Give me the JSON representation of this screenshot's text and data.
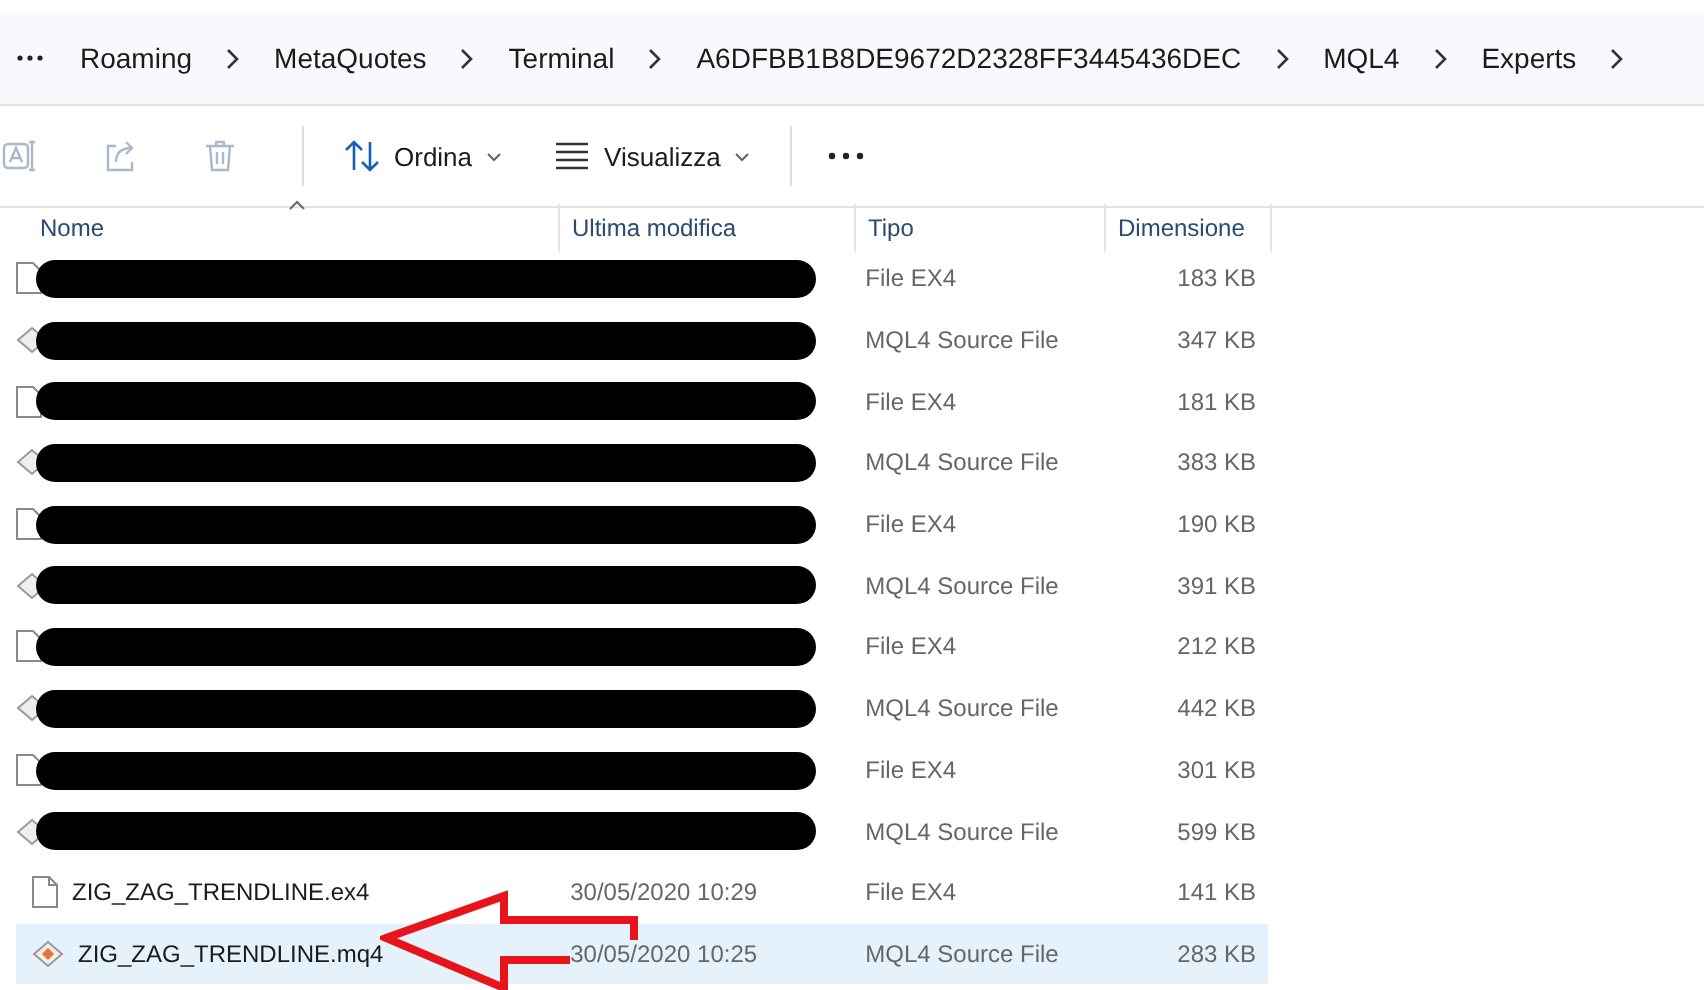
{
  "breadcrumb": [
    "Roaming",
    "MetaQuotes",
    "Terminal",
    "A6DFBB1B8DE9672D2328FF3445436DEC",
    "MQL4",
    "Experts"
  ],
  "toolbar": {
    "actions": [
      {
        "kind": "rename",
        "disabled": true
      },
      {
        "kind": "share",
        "disabled": true
      },
      {
        "kind": "delete",
        "disabled": true
      }
    ],
    "sort": "Ordina",
    "view": "Visualizza"
  },
  "columns": [
    "Nome",
    "Ultima modifica",
    "Tipo",
    "Dimensione"
  ],
  "rows": [
    {
      "kind": "ex4",
      "redacted": true,
      "type": "File EX4",
      "size": "183 KB",
      "selected": false
    },
    {
      "kind": "mq4",
      "redacted": true,
      "type": "MQL4 Source File",
      "size": "347 KB",
      "selected": false
    },
    {
      "kind": "ex4",
      "redacted": true,
      "type": "File EX4",
      "size": "181 KB",
      "selected": false
    },
    {
      "kind": "mq4",
      "redacted": true,
      "type": "MQL4 Source File",
      "size": "383 KB",
      "selected": false
    },
    {
      "kind": "ex4",
      "redacted": true,
      "type": "File EX4",
      "size": "190 KB",
      "selected": false
    },
    {
      "kind": "mq4",
      "redacted": true,
      "type": "MQL4 Source File",
      "size": "391 KB",
      "selected": false
    },
    {
      "kind": "ex4",
      "redacted": true,
      "type": "File EX4",
      "size": "212 KB",
      "selected": false
    },
    {
      "kind": "mq4",
      "redacted": true,
      "type": "MQL4 Source File",
      "size": "442 KB",
      "selected": false
    },
    {
      "kind": "ex4",
      "redacted": true,
      "type": "File EX4",
      "size": "301 KB",
      "selected": false
    },
    {
      "kind": "mq4",
      "redacted": true,
      "type": "MQL4 Source File",
      "size": "599 KB",
      "selected": false
    },
    {
      "kind": "ex4",
      "redacted": false,
      "name": "ZIG_ZAG_TRENDLINE.ex4",
      "modified": "30/05/2020 10:29",
      "type": "File EX4",
      "size": "141 KB",
      "selected": false
    },
    {
      "kind": "mq4",
      "redacted": false,
      "name": "ZIG_ZAG_TRENDLINE.mq4",
      "modified": "30/05/2020 10:25",
      "type": "MQL4 Source File",
      "size": "283 KB",
      "selected": true
    }
  ]
}
